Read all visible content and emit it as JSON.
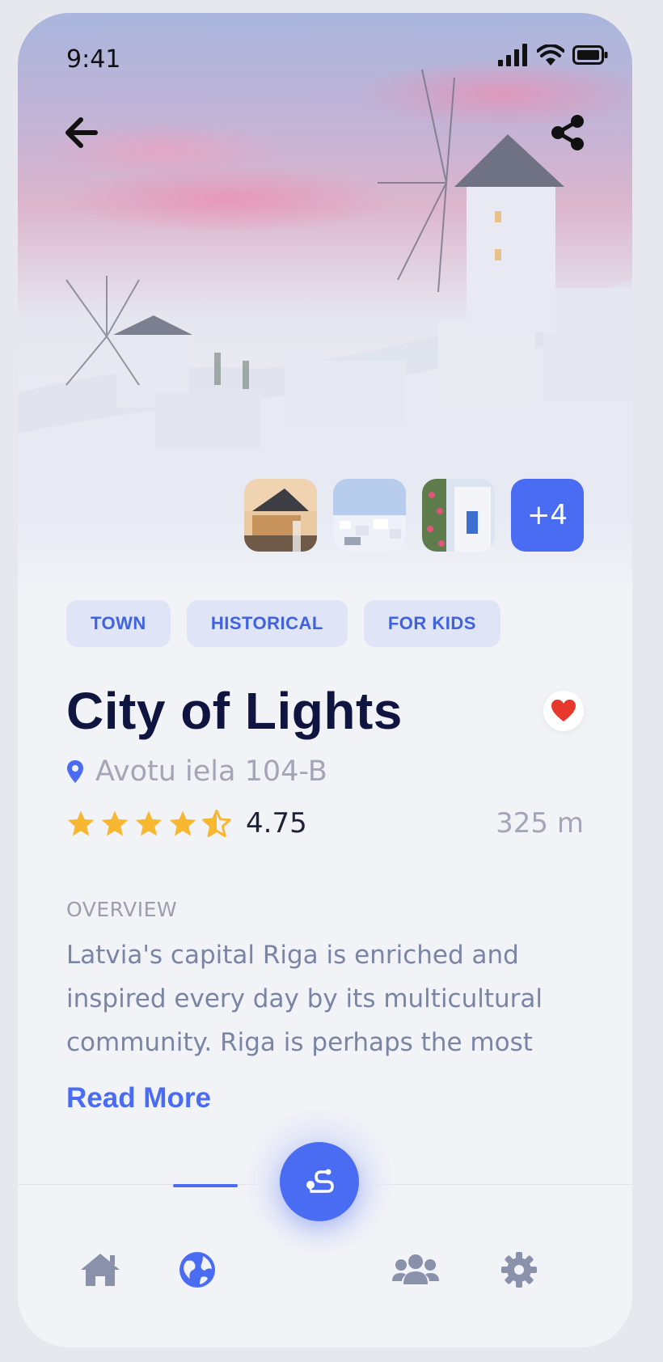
{
  "status_bar": {
    "time": "9:41"
  },
  "header": {
    "back_icon": "arrow-left-icon",
    "share_icon": "share-icon"
  },
  "gallery": {
    "more_label": "+4"
  },
  "tags": [
    "TOWN",
    "HISTORICAL",
    "FOR KIDS"
  ],
  "place": {
    "title": "City of Lights",
    "favorite": true,
    "address": "Avotu iela 104-B",
    "rating": 4.75,
    "rating_label": "4.75",
    "distance": "325 m"
  },
  "overview": {
    "label": "OVERVIEW",
    "text": "Latvia's capital Riga is enriched and inspired every day by its multicultural community. Riga is perhaps the most",
    "read_more": "Read More"
  },
  "nav": {
    "items": [
      "home-icon",
      "globe-icon",
      "route-icon",
      "users-icon",
      "gear-icon"
    ],
    "active": "globe-icon"
  },
  "colors": {
    "accent": "#4a6cf2",
    "title": "#0f1540",
    "star": "#f7b731",
    "heart": "#e8372c"
  }
}
